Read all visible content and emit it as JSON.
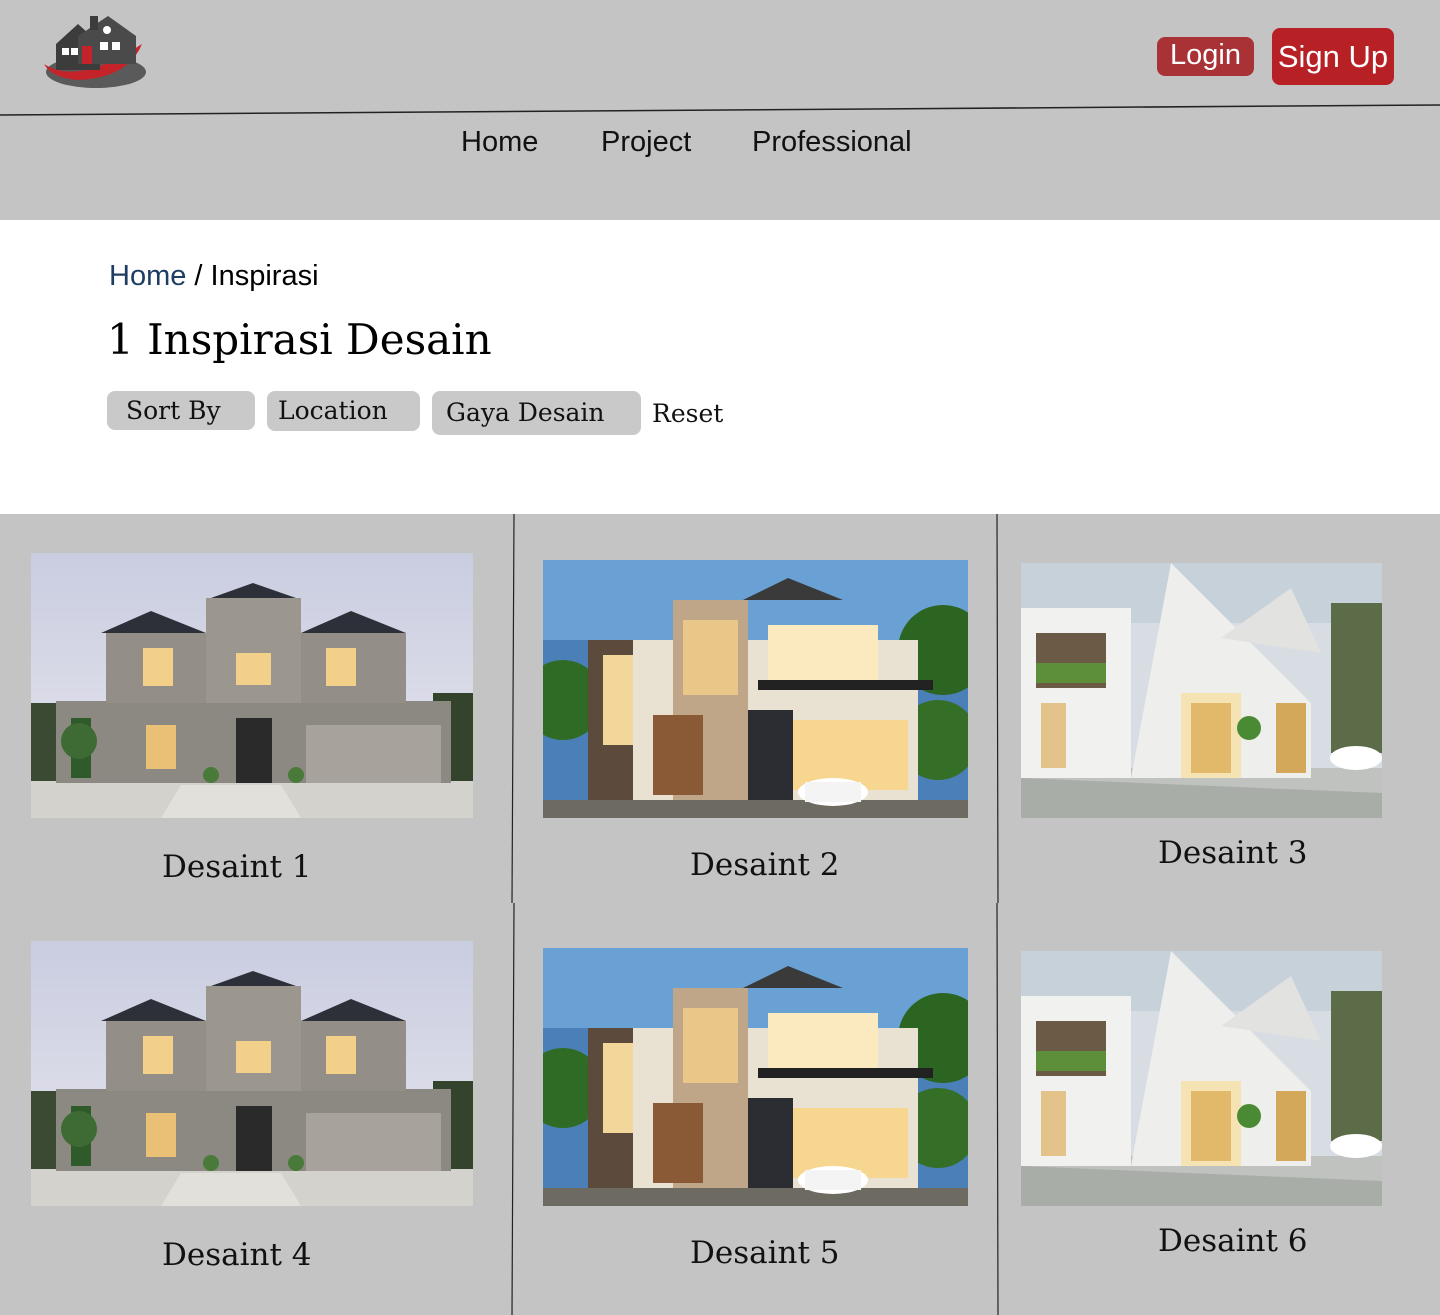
{
  "header": {
    "logo_icon": "house-logo-icon",
    "login_label": "Login",
    "signup_label": "Sign Up",
    "colors": {
      "header_bg": "#c4c4c4",
      "login_bg": "#a83236",
      "signup_bg": "#b72126"
    }
  },
  "nav": {
    "items": [
      {
        "label": "Home"
      },
      {
        "label": "Project"
      },
      {
        "label": "Professional"
      }
    ]
  },
  "breadcrumb": {
    "home": "Home",
    "separator": " / ",
    "current": "Inspirasi"
  },
  "page": {
    "title": "1 Inspirasi Desain"
  },
  "filters": {
    "sort_by": "Sort By",
    "location": "Location",
    "gaya_desain": "Gaya Desain",
    "reset": "Reset"
  },
  "designs": [
    {
      "label": "Desaint 1",
      "style": "classic"
    },
    {
      "label": "Desaint 2",
      "style": "modern-tropical"
    },
    {
      "label": "Desaint 3",
      "style": "minimalist-white"
    },
    {
      "label": "Desaint 4",
      "style": "classic"
    },
    {
      "label": "Desaint 5",
      "style": "modern-tropical"
    },
    {
      "label": "Desaint 6",
      "style": "minimalist-white"
    }
  ]
}
